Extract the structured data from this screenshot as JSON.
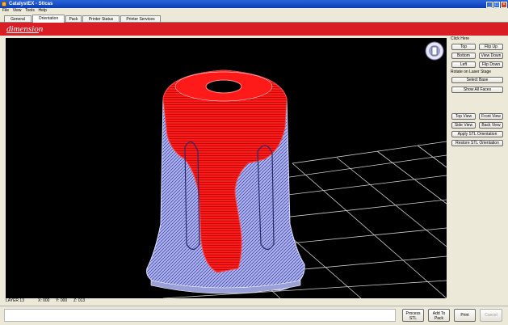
{
  "window": {
    "title": "CatalystEX - Stlcas"
  },
  "menu": [
    "File",
    "View",
    "Tools",
    "Help"
  ],
  "tabs": [
    "General",
    "Orientation",
    "Pack",
    "Printer Status",
    "Printer Services"
  ],
  "brand": {
    "logo_text": "dimension",
    "color": "#d81e24"
  },
  "status": {
    "layer": "LAYER 13",
    "x": "X: 000",
    "y": "Y: 000",
    "z": "Z: 013"
  },
  "panel": {
    "section1_label": "Click Here",
    "view_buttons": [
      "Top",
      "Flip Up",
      "Bottom",
      "View Down",
      "Left",
      "Flip Down"
    ],
    "section2_label": "Rotate on Laser Stage",
    "select_button": "Select Base",
    "show_all_button": "Show All Faces",
    "lock_buttons": [
      "Top View",
      "Front View",
      "Side View",
      "Back View"
    ],
    "apply_button": "Apply STL Orientation",
    "restore_button": "Restore STL Orientation"
  },
  "bottom": {
    "process_button": "Process STL",
    "add_button": "Add To Pack",
    "print_button": "Print",
    "cancel_button": "Cancel"
  },
  "colors": {
    "model_red": "#ff1a1a",
    "model_blue": "#aab0f5",
    "grid": "#cfcfcf",
    "viewport_bg": "#000000"
  }
}
